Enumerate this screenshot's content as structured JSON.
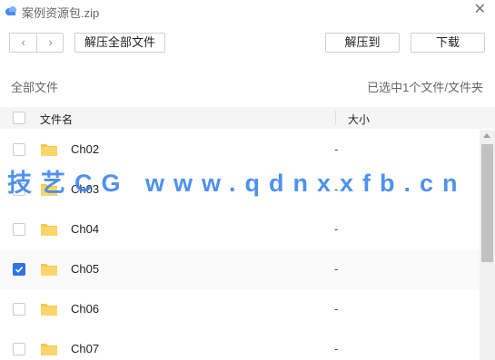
{
  "window": {
    "title": "案例资源包.zip",
    "close_icon": "close-icon"
  },
  "toolbar": {
    "back_icon": "chevron-left-icon",
    "forward_icon": "chevron-right-icon",
    "extract_all_label": "解压全部文件",
    "extract_to_label": "解压到",
    "download_label": "下载"
  },
  "breadcrumb": "全部文件",
  "selection_status": "已选中1个文件/文件夹",
  "list": {
    "col_name": "文件名",
    "col_size": "大小",
    "items": [
      {
        "name": "Ch02",
        "size": "-",
        "checked": false
      },
      {
        "name": "Ch03",
        "size": "-",
        "checked": false
      },
      {
        "name": "Ch04",
        "size": "-",
        "checked": false
      },
      {
        "name": "Ch05",
        "size": "-",
        "checked": true
      },
      {
        "name": "Ch06",
        "size": "-",
        "checked": false
      },
      {
        "name": "Ch07",
        "size": "-",
        "checked": false
      }
    ]
  },
  "watermark": "技艺CG www.qdnxxfb.cn",
  "colors": {
    "accent": "#2f73e6",
    "folder": "#f7c94a",
    "watermark": "#3b86f0"
  }
}
